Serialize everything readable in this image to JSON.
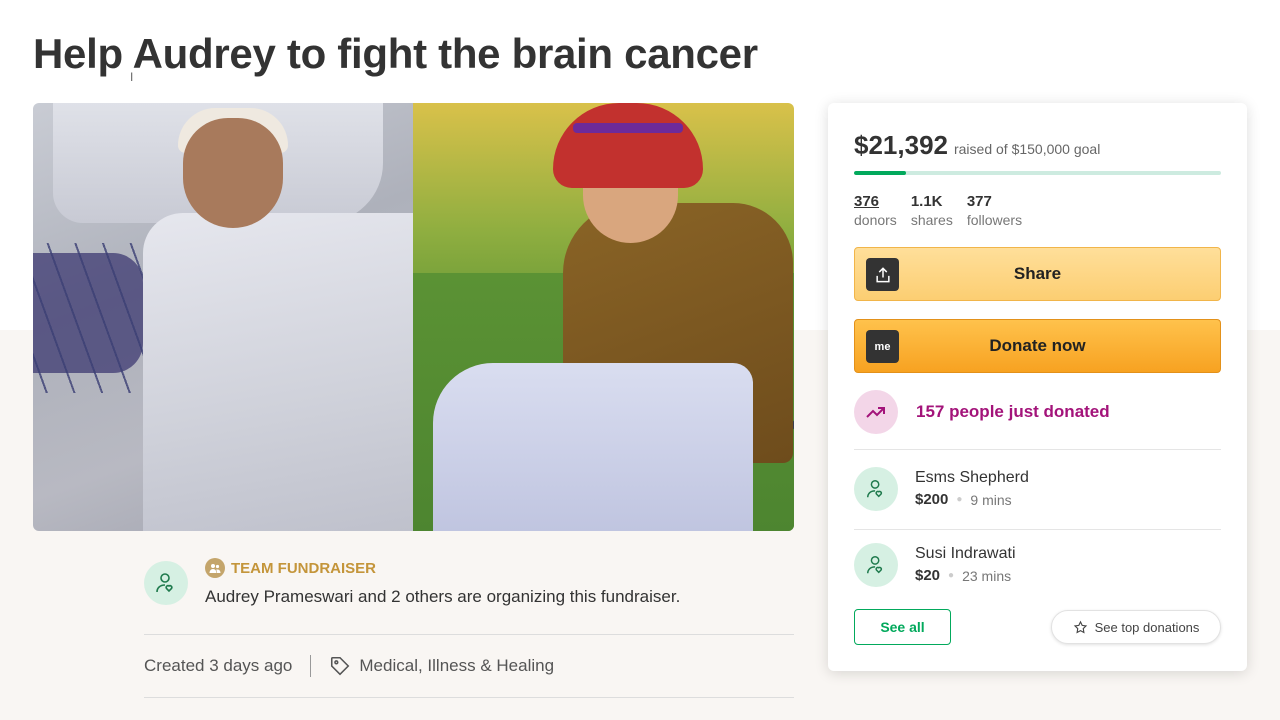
{
  "page": {
    "title": "Help Audrey to fight the brain cancer"
  },
  "organizer": {
    "team_label": "TEAM FUNDRAISER",
    "text": "Audrey Prameswari and 2 others are organizing this fundraiser."
  },
  "meta": {
    "created": "Created 3 days ago",
    "category": "Medical, Illness & Healing"
  },
  "card": {
    "raised": "$21,392",
    "goal_text": "raised of $150,000 goal",
    "progress_fraction": 0.1426,
    "stats": [
      {
        "value": "376",
        "label": "donors"
      },
      {
        "value": "1.1K",
        "label": "shares"
      },
      {
        "value": "377",
        "label": "followers"
      }
    ],
    "share_label": "Share",
    "donate_label": "Donate now",
    "donate_icon_text": "me",
    "trend_text": "157 people just donated",
    "donations": [
      {
        "name": "Esms Shepherd",
        "amount": "$200",
        "time": "9 mins"
      },
      {
        "name": "Susi Indrawati",
        "amount": "$20",
        "time": "23 mins"
      }
    ],
    "see_all_label": "See all",
    "see_top_label": "See top donations"
  },
  "colors": {
    "brand_green": "#02a95c",
    "donate_orange": "#f7a221",
    "share_yellow": "#fcce72",
    "trend_magenta": "#a3137a",
    "team_gold": "#c4953a"
  },
  "icons": [
    "upload-icon",
    "gofundme-logo-icon",
    "trending-up-icon",
    "donor-heart-icon",
    "team-icon",
    "tag-icon",
    "star-icon"
  ]
}
